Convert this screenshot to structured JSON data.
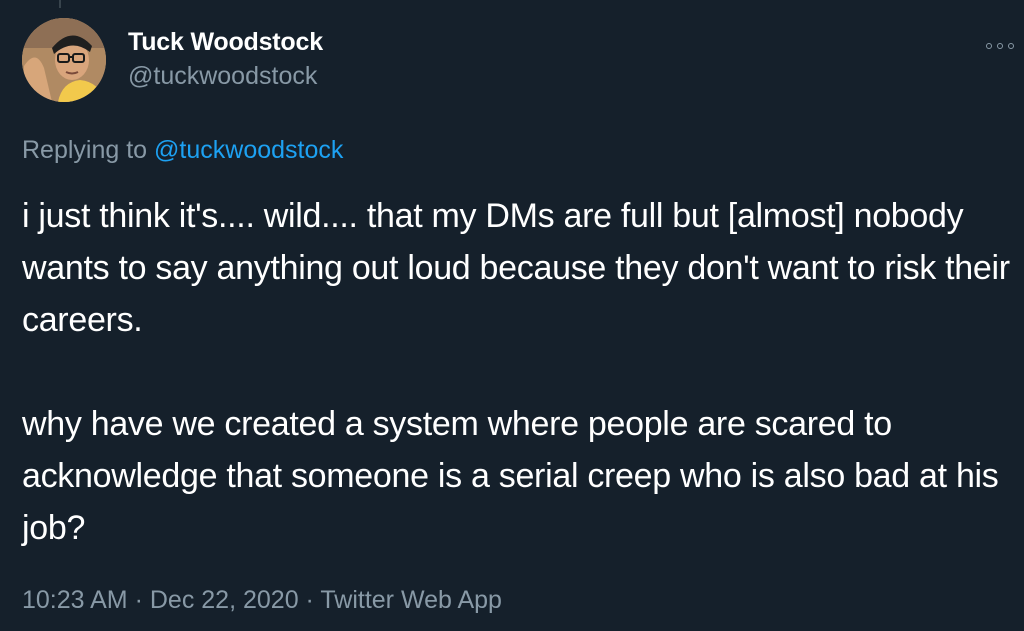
{
  "author": {
    "display_name": "Tuck Woodstock",
    "handle": "@tuckwoodstock"
  },
  "more_icon": "more-dots-icon",
  "reply": {
    "prefix": "Replying to",
    "mention": "@tuckwoodstock"
  },
  "tweet": {
    "paragraphs": [
      "i just think it's.... wild.... that my DMs are full but [almost] nobody wants to say anything out loud because they don't want to risk their careers.",
      "why have we created a system where people are scared to acknowledge that someone is a serial creep who is also bad at his job?"
    ]
  },
  "meta": {
    "time": "10:23 AM",
    "separator": "·",
    "date": "Dec 22, 2020",
    "source": "Twitter Web App"
  },
  "colors": {
    "background": "#15202b",
    "text": "#ffffff",
    "secondary": "#8899a6",
    "link": "#1da1f2"
  }
}
